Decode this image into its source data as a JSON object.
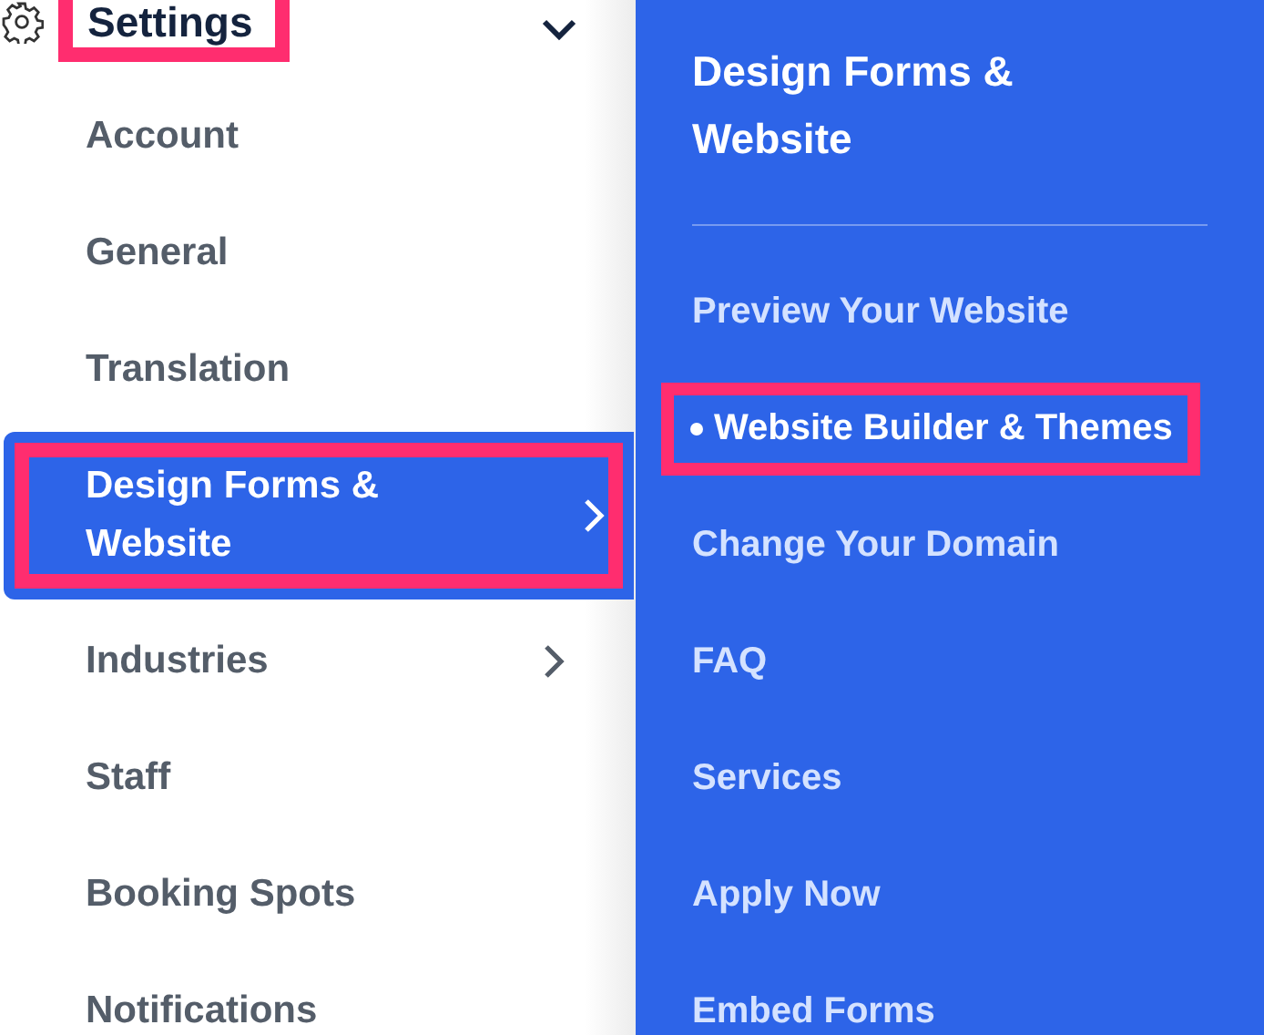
{
  "sidebar": {
    "header": {
      "label": "Settings",
      "expanded": true,
      "highlighted": true
    },
    "items": [
      {
        "label": "Account",
        "selected": false,
        "submenu": false,
        "highlighted": false
      },
      {
        "label": "General",
        "selected": false,
        "submenu": false,
        "highlighted": false
      },
      {
        "label": "Translation",
        "selected": false,
        "submenu": false,
        "highlighted": false
      },
      {
        "label": "Design Forms & Website",
        "selected": true,
        "submenu": true,
        "highlighted": true
      },
      {
        "label": "Industries",
        "selected": false,
        "submenu": true,
        "highlighted": false
      },
      {
        "label": "Staff",
        "selected": false,
        "submenu": false,
        "highlighted": false
      },
      {
        "label": "Booking Spots",
        "selected": false,
        "submenu": false,
        "highlighted": false
      },
      {
        "label": "Notifications",
        "selected": false,
        "submenu": false,
        "highlighted": false
      }
    ]
  },
  "submenu": {
    "title": "Design Forms & Website",
    "items": [
      {
        "label": "Preview Your Website",
        "selected": false,
        "highlighted": false
      },
      {
        "label": "Website Builder & Themes",
        "selected": true,
        "highlighted": true
      },
      {
        "label": "Change Your Domain",
        "selected": false,
        "highlighted": false
      },
      {
        "label": "FAQ",
        "selected": false,
        "highlighted": false
      },
      {
        "label": "Services",
        "selected": false,
        "highlighted": false
      },
      {
        "label": "Apply Now",
        "selected": false,
        "highlighted": false
      },
      {
        "label": "Embed Forms",
        "selected": false,
        "highlighted": false
      }
    ]
  }
}
